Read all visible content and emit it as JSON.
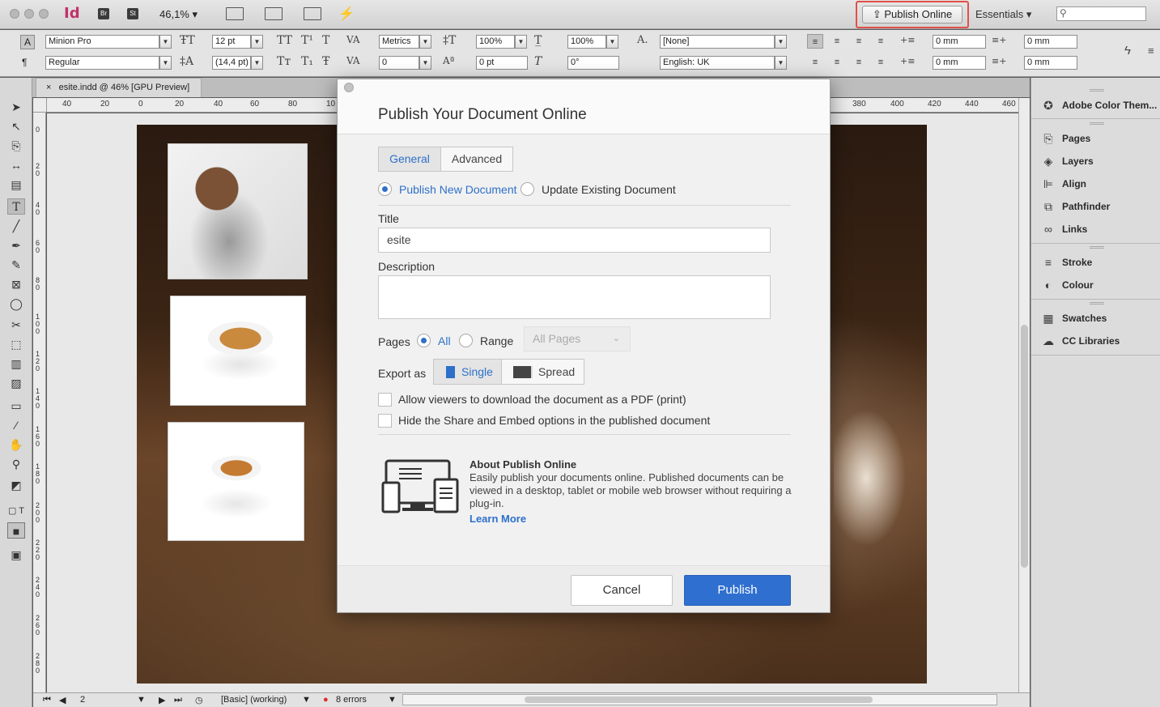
{
  "app": {
    "logo": "Id",
    "bridge_badge": "Br",
    "stock_badge": "St",
    "zoom": "46,1%",
    "publish_online_label": "Publish Online",
    "workspace": "Essentials"
  },
  "control_bar": {
    "font_family": "Minion Pro",
    "font_style": "Regular",
    "font_size": "12 pt",
    "leading": "(14,4 pt)",
    "kerning": "Metrics",
    "tracking": "0",
    "vertical_scale": "100%",
    "horizontal_scale": "100%",
    "baseline_shift": "0 pt",
    "skew": "0°",
    "char_style": "[None]",
    "language": "English: UK",
    "left_indent": "0 mm",
    "right_indent": "0 mm",
    "first_line_indent": "0 mm",
    "last_line_indent": "0 mm"
  },
  "document": {
    "tab_title": "esite.indd @ 46% [GPU Preview]",
    "h_ruler_ticks": [
      "40",
      "20",
      "0",
      "20",
      "40",
      "60",
      "80",
      "10",
      "380",
      "400",
      "420",
      "440",
      "460"
    ],
    "v_ruler_ticks": [
      "0",
      "20",
      "40",
      "60",
      "80",
      "100",
      "120",
      "140",
      "160",
      "180",
      "200",
      "220",
      "240",
      "260",
      "280"
    ]
  },
  "status_bar": {
    "page": "2",
    "style": "[Basic] (working)",
    "errors": "8 errors"
  },
  "panels": {
    "items": [
      {
        "label": "Adobe Color Them...",
        "icon": "color-themes-icon"
      },
      {
        "label": "Pages",
        "icon": "pages-icon"
      },
      {
        "label": "Layers",
        "icon": "layers-icon"
      },
      {
        "label": "Align",
        "icon": "align-icon"
      },
      {
        "label": "Pathfinder",
        "icon": "pathfinder-icon"
      },
      {
        "label": "Links",
        "icon": "links-icon"
      },
      {
        "label": "Stroke",
        "icon": "stroke-icon"
      },
      {
        "label": "Colour",
        "icon": "colour-icon"
      },
      {
        "label": "Swatches",
        "icon": "swatches-icon"
      },
      {
        "label": "CC Libraries",
        "icon": "cc-libraries-icon"
      }
    ]
  },
  "dialog": {
    "title": "Publish Your Document Online",
    "tabs": [
      "General",
      "Advanced"
    ],
    "publish_new": "Publish New Document",
    "update_existing": "Update Existing Document",
    "title_label": "Title",
    "title_value": "esite",
    "description_label": "Description",
    "description_value": "",
    "pages_label": "Pages",
    "pages_all": "All",
    "pages_range": "Range",
    "pages_select": "All Pages",
    "export_as_label": "Export as",
    "export_single": "Single",
    "export_spread": "Spread",
    "allow_pdf": "Allow viewers to download the document as a PDF (print)",
    "hide_share": "Hide the Share and Embed options in the published document",
    "about_title": "About Publish Online",
    "about_body": "Easily publish your documents online. Published documents can be viewed in a desktop, tablet or mobile web browser without requiring a plug-in.",
    "learn_more": "Learn More",
    "cancel": "Cancel",
    "publish": "Publish"
  },
  "colors": {
    "accent": "#2d70c9",
    "highlight": "#e0504a",
    "logo": "#c2306b"
  }
}
